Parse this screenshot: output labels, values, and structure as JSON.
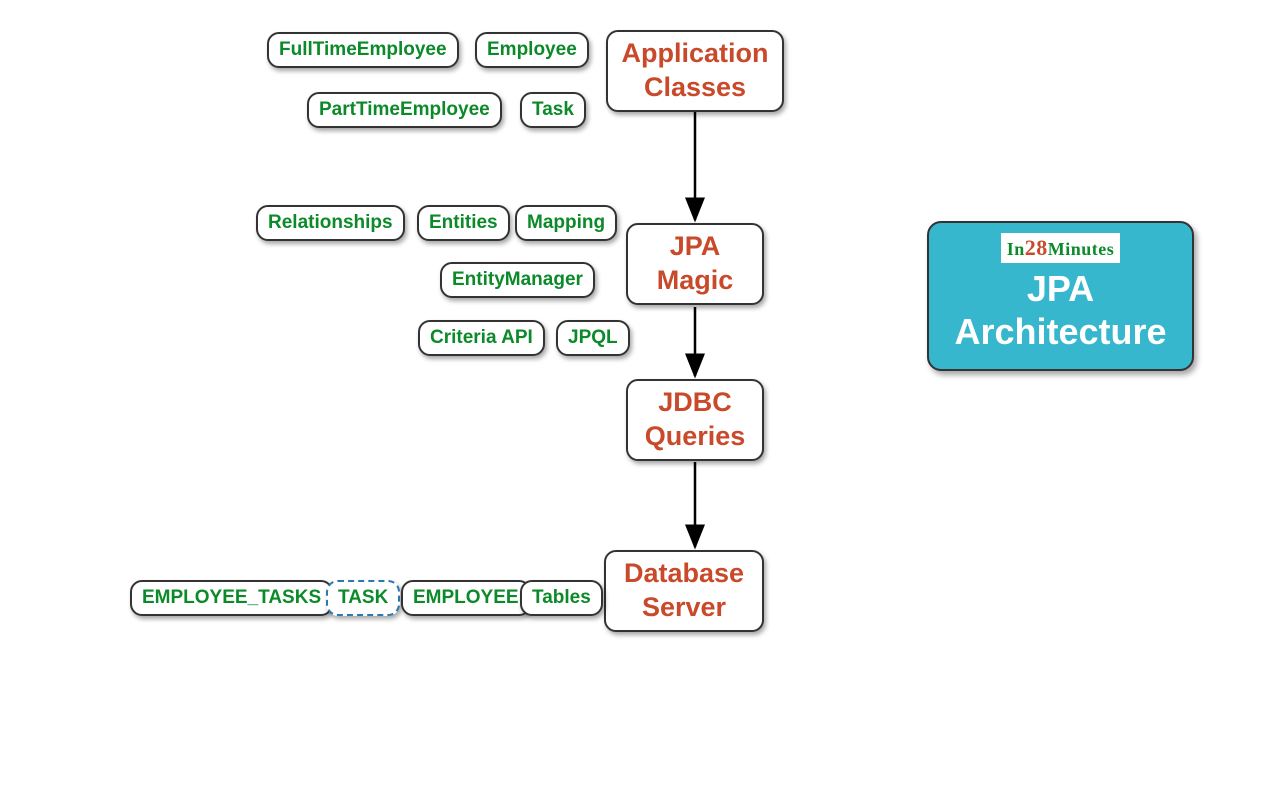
{
  "diagram": {
    "mainNodes": {
      "applicationClasses": "Application\nClasses",
      "jpaMagic": "JPA\nMagic",
      "jdbcQueries": "JDBC\nQueries",
      "databaseServer": "Database\nServer"
    },
    "appClassesChildren": {
      "fullTimeEmployee": "FullTimeEmployee",
      "employee": "Employee",
      "partTimeEmployee": "PartTimeEmployee",
      "task": "Task"
    },
    "jpaMagicChildren": {
      "relationships": "Relationships",
      "entities": "Entities",
      "mapping": "Mapping",
      "entityManager": "EntityManager",
      "criteriaApi": "Criteria API",
      "jpql": "JPQL"
    },
    "dbServerChildren": {
      "employeeTasks": "EMPLOYEE_TASKS",
      "task": "TASK",
      "employee": "EMPLOYEE",
      "tables": "Tables"
    },
    "titleCard": {
      "brandIn": "In",
      "brandNum": "28",
      "brandMinutes": "Minutes",
      "title": "JPA\nArchitecture"
    }
  }
}
